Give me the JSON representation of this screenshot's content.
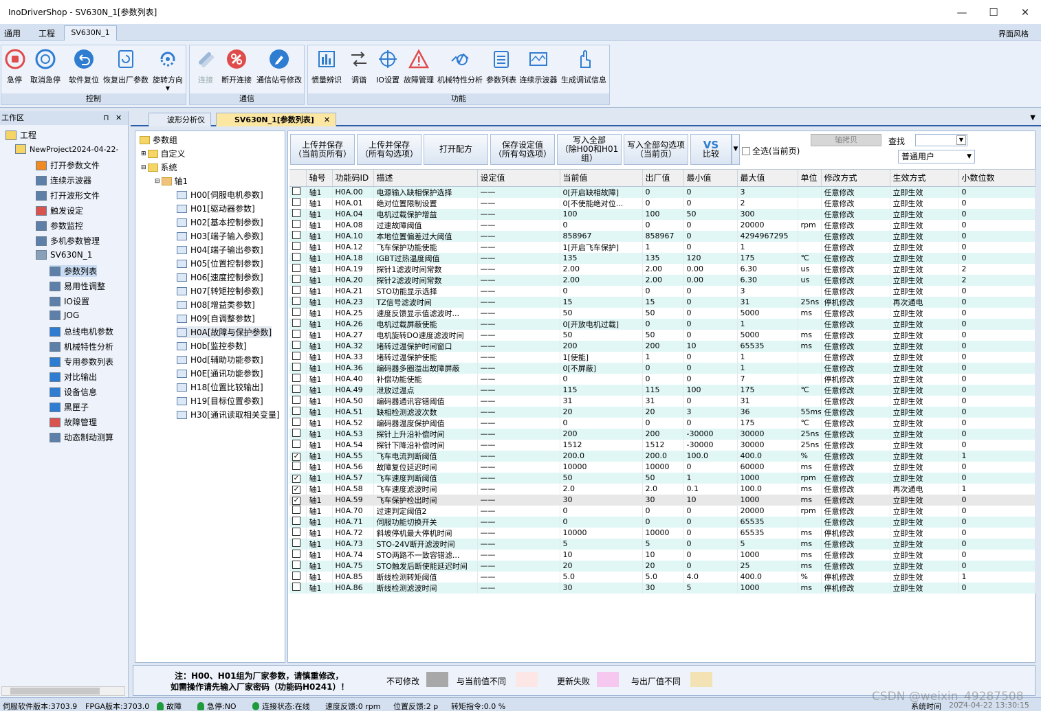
{
  "window": {
    "title": "InoDriverShop - SV630N_1[参数列表]",
    "buttons": [
      "—",
      "☐",
      "✕"
    ]
  },
  "menu": {
    "general": "通用",
    "project": "工程",
    "device_tab": "SV630N_1",
    "style": "界面风格"
  },
  "ribbon": {
    "control": {
      "label": "控制",
      "buttons": [
        "急停",
        "取消急停",
        "软件复位",
        "恢复出厂参数",
        "旋转方向"
      ]
    },
    "comm": {
      "label": "通信",
      "buttons": [
        "连接",
        "断开连接",
        "通信站号修改"
      ]
    },
    "func": {
      "label": "功能",
      "buttons": [
        "惯量辨识",
        "调谐",
        "IO设置",
        "故障管理",
        "机械特性分析",
        "参数列表",
        "连续示波器",
        "生成调试信息"
      ]
    }
  },
  "workspace": {
    "title": "工作区",
    "pin": "📌",
    "close": "✕",
    "items": [
      "工程",
      "NewProject2024-04-22-",
      "打开参数文件",
      "连续示波器",
      "打开波形文件",
      "触发设定",
      "参数监控",
      "多机参数管理",
      "SV630N_1",
      "参数列表",
      "易用性调整",
      "IO设置",
      "JOG",
      "总线电机参数",
      "机械特性分析",
      "专用参数列表",
      "对比输出",
      "设备信息",
      "黑匣子",
      "故障管理",
      "动态制动测算"
    ]
  },
  "tabs": [
    "波形分析仪",
    "SV630N_1[参数列表]"
  ],
  "tree": {
    "root": "参数组",
    "custom": "自定义",
    "system": "系统",
    "axis": "轴1",
    "groups": [
      "H00[伺服电机参数]",
      "H01[驱动器参数]",
      "H02[基本控制参数]",
      "H03[端子输入参数]",
      "H04[端子输出参数]",
      "H05[位置控制参数]",
      "H06[速度控制参数]",
      "H07[转矩控制参数]",
      "H08[增益类参数]",
      "H09[自调整参数]",
      "H0A[故障与保护参数]",
      "H0b[监控参数]",
      "H0d[辅助功能参数]",
      "H0E[通讯功能参数]",
      "H18[位置比较输出]",
      "H19[目标位置参数]",
      "H30[通讯读取相关变量]"
    ]
  },
  "toolbar": {
    "upload_page": [
      "上传并保存",
      "（当前页所有）"
    ],
    "upload_checked": [
      "上传并保存",
      "（所有勾选项）"
    ],
    "open_recipe": "打开配方",
    "save_set": [
      "保存设定值",
      "（所有勾选项）"
    ],
    "write_all": [
      "写入全部",
      "（除H00和H01组）"
    ],
    "write_checked": [
      "写入全部勾选项",
      "（当前页）"
    ],
    "compare": "比较",
    "compare_logo": "VS",
    "select_all": "全选(当前页)",
    "axis_copy": "轴拷贝",
    "find": "查找",
    "user": "普通用户"
  },
  "columns": [
    "",
    "轴号",
    "功能码ID",
    "描述",
    "设定值",
    "当前值",
    "出厂值",
    "最小值",
    "最大值",
    "单位",
    "修改方式",
    "生效方式",
    "小数位数"
  ],
  "rows": [
    [
      "",
      "轴1",
      "H0A.00",
      "电源输入缺相保护选择",
      "——",
      "0[开启缺相故障]",
      "0",
      "0",
      "3",
      "",
      "任意修改",
      "立即生效",
      "0"
    ],
    [
      "",
      "轴1",
      "H0A.01",
      "绝对位置限制设置",
      "——",
      "0[不使能绝对位...",
      "0",
      "0",
      "2",
      "",
      "任意修改",
      "立即生效",
      "0"
    ],
    [
      "",
      "轴1",
      "H0A.04",
      "电机过载保护增益",
      "——",
      "100",
      "100",
      "50",
      "300",
      "",
      "任意修改",
      "立即生效",
      "0"
    ],
    [
      "",
      "轴1",
      "H0A.08",
      "过速故障阈值",
      "——",
      "0",
      "0",
      "0",
      "20000",
      "rpm",
      "任意修改",
      "立即生效",
      "0"
    ],
    [
      "",
      "轴1",
      "H0A.10",
      "本地位置偏差过大阈值",
      "——",
      "858967",
      "858967",
      "0",
      "4294967295",
      "",
      "任意修改",
      "立即生效",
      "0"
    ],
    [
      "",
      "轴1",
      "H0A.12",
      "飞车保护功能使能",
      "——",
      "1[开启飞车保护]",
      "1",
      "0",
      "1",
      "",
      "任意修改",
      "立即生效",
      "0"
    ],
    [
      "",
      "轴1",
      "H0A.18",
      "IGBT过热温度阈值",
      "——",
      "135",
      "135",
      "120",
      "175",
      "℃",
      "任意修改",
      "立即生效",
      "0"
    ],
    [
      "",
      "轴1",
      "H0A.19",
      "探针1滤波时间常数",
      "——",
      "2.00",
      "2.00",
      "0.00",
      "6.30",
      "us",
      "任意修改",
      "立即生效",
      "2"
    ],
    [
      "",
      "轴1",
      "H0A.20",
      "探针2滤波时间常数",
      "——",
      "2.00",
      "2.00",
      "0.00",
      "6.30",
      "us",
      "任意修改",
      "立即生效",
      "2"
    ],
    [
      "",
      "轴1",
      "H0A.21",
      "STO功能显示选择",
      "——",
      "0",
      "0",
      "0",
      "3",
      "",
      "任意修改",
      "立即生效",
      "0"
    ],
    [
      "",
      "轴1",
      "H0A.23",
      "TZ信号滤波时间",
      "——",
      "15",
      "15",
      "0",
      "31",
      "25ns",
      "停机修改",
      "再次通电",
      "0"
    ],
    [
      "",
      "轴1",
      "H0A.25",
      "速度反馈显示值滤波时...",
      "——",
      "50",
      "50",
      "0",
      "5000",
      "ms",
      "任意修改",
      "立即生效",
      "0"
    ],
    [
      "",
      "轴1",
      "H0A.26",
      "电机过载屏蔽使能",
      "——",
      "0[开放电机过载]",
      "0",
      "0",
      "1",
      "",
      "任意修改",
      "立即生效",
      "0"
    ],
    [
      "",
      "轴1",
      "H0A.27",
      "电机旋转DO速度滤波时间",
      "——",
      "50",
      "50",
      "0",
      "5000",
      "ms",
      "任意修改",
      "立即生效",
      "0"
    ],
    [
      "",
      "轴1",
      "H0A.32",
      "堵转过温保护时间窗口",
      "——",
      "200",
      "200",
      "10",
      "65535",
      "ms",
      "任意修改",
      "立即生效",
      "0"
    ],
    [
      "",
      "轴1",
      "H0A.33",
      "堵转过温保护使能",
      "——",
      "1[使能]",
      "1",
      "0",
      "1",
      "",
      "任意修改",
      "立即生效",
      "0"
    ],
    [
      "",
      "轴1",
      "H0A.36",
      "编码器多圈溢出故障屏蔽",
      "——",
      "0[不屏蔽]",
      "0",
      "0",
      "1",
      "",
      "任意修改",
      "立即生效",
      "0"
    ],
    [
      "",
      "轴1",
      "H0A.40",
      "补偿功能使能",
      "——",
      "0",
      "0",
      "0",
      "7",
      "",
      "停机修改",
      "立即生效",
      "0"
    ],
    [
      "",
      "轴1",
      "H0A.49",
      "泄放过温点",
      "——",
      "115",
      "115",
      "100",
      "175",
      "℃",
      "任意修改",
      "立即生效",
      "0"
    ],
    [
      "",
      "轴1",
      "H0A.50",
      "编码器通讯容错阈值",
      "——",
      "31",
      "31",
      "0",
      "31",
      "",
      "任意修改",
      "立即生效",
      "0"
    ],
    [
      "",
      "轴1",
      "H0A.51",
      "缺相检测滤波次数",
      "——",
      "20",
      "20",
      "3",
      "36",
      "55ms",
      "任意修改",
      "立即生效",
      "0"
    ],
    [
      "",
      "轴1",
      "H0A.52",
      "编码器温度保护阈值",
      "——",
      "0",
      "0",
      "0",
      "175",
      "℃",
      "任意修改",
      "立即生效",
      "0"
    ],
    [
      "",
      "轴1",
      "H0A.53",
      "探针上升沿补偿时间",
      "——",
      "200",
      "200",
      "-30000",
      "30000",
      "25ns",
      "任意修改",
      "立即生效",
      "0"
    ],
    [
      "",
      "轴1",
      "H0A.54",
      "探针下降沿补偿时间",
      "——",
      "1512",
      "1512",
      "-30000",
      "30000",
      "25ns",
      "任意修改",
      "立即生效",
      "0"
    ],
    [
      "✓",
      "轴1",
      "H0A.55",
      "飞车电流判断阈值",
      "——",
      "200.0",
      "200.0",
      "100.0",
      "400.0",
      "%",
      "任意修改",
      "立即生效",
      "1"
    ],
    [
      "",
      "轴1",
      "H0A.56",
      "故障复位延迟时间",
      "——",
      "10000",
      "10000",
      "0",
      "60000",
      "ms",
      "任意修改",
      "立即生效",
      "0"
    ],
    [
      "✓",
      "轴1",
      "H0A.57",
      "飞车速度判断阈值",
      "——",
      "50",
      "50",
      "1",
      "1000",
      "rpm",
      "任意修改",
      "立即生效",
      "0"
    ],
    [
      "✓",
      "轴1",
      "H0A.58",
      "飞车速度滤波时间",
      "——",
      "2.0",
      "2.0",
      "0.1",
      "100.0",
      "ms",
      "任意修改",
      "再次通电",
      "1"
    ],
    [
      "✓",
      "轴1",
      "H0A.59",
      "飞车保护检出时间",
      "——",
      "30",
      "30",
      "10",
      "1000",
      "ms",
      "任意修改",
      "立即生效",
      "0"
    ],
    [
      "",
      "轴1",
      "H0A.70",
      "过速判定阈值2",
      "——",
      "0",
      "0",
      "0",
      "20000",
      "rpm",
      "任意修改",
      "立即生效",
      "0"
    ],
    [
      "",
      "轴1",
      "H0A.71",
      "伺服功能切换开关",
      "——",
      "0",
      "0",
      "0",
      "65535",
      "",
      "任意修改",
      "立即生效",
      "0"
    ],
    [
      "",
      "轴1",
      "H0A.72",
      "斜坡停机最大停机时间",
      "——",
      "10000",
      "10000",
      "0",
      "65535",
      "ms",
      "停机修改",
      "立即生效",
      "0"
    ],
    [
      "",
      "轴1",
      "H0A.73",
      "STO-24V断开滤波时间",
      "——",
      "5",
      "5",
      "0",
      "5",
      "ms",
      "任意修改",
      "立即生效",
      "0"
    ],
    [
      "",
      "轴1",
      "H0A.74",
      "STO两路不一致容错滤...",
      "——",
      "10",
      "10",
      "0",
      "1000",
      "ms",
      "任意修改",
      "立即生效",
      "0"
    ],
    [
      "",
      "轴1",
      "H0A.75",
      "STO触发后断使能延迟时间",
      "——",
      "20",
      "20",
      "0",
      "25",
      "ms",
      "任意修改",
      "立即生效",
      "0"
    ],
    [
      "",
      "轴1",
      "H0A.85",
      "断线检测转矩阈值",
      "——",
      "5.0",
      "5.0",
      "4.0",
      "400.0",
      "%",
      "停机修改",
      "立即生效",
      "1"
    ],
    [
      "",
      "轴1",
      "H0A.86",
      "断线检测滤波时间",
      "——",
      "30",
      "30",
      "5",
      "1000",
      "ms",
      "停机修改",
      "立即生效",
      "0"
    ]
  ],
  "legend": {
    "note1": "注：H00、H01组为厂家参数，请慎重修改，",
    "note2": "如需操作请先输入厂家密码（功能码H0241）！",
    "items": [
      {
        "label": "不可修改",
        "color": "#a8a8a8"
      },
      {
        "label": "与当前值不同",
        "color": "#fde6e6"
      },
      {
        "label": "更新失败",
        "color": "#f6c7ef"
      },
      {
        "label": "与出厂值不同",
        "color": "#f3e3b4"
      }
    ]
  },
  "status": {
    "servo": "伺服软件版本:3703.9",
    "fpga": "FPGA版本:3703.0",
    "fault": "故障",
    "estop": "急停:NO",
    "conn": "连接状态:在线",
    "speed": "速度反馈:0 rpm",
    "pos": "位置反馈:2 p",
    "torque": "转矩指令:0.0 %",
    "systime_label": "系统时间",
    "systime": "2024-04-22 13:30:15",
    "watermark": "CSDN @weixin_49287508"
  },
  "colors": {
    "accent": "#2a5ea8",
    "tab_active": "#fbe6a2",
    "row_alt": "#e0f7f5"
  }
}
